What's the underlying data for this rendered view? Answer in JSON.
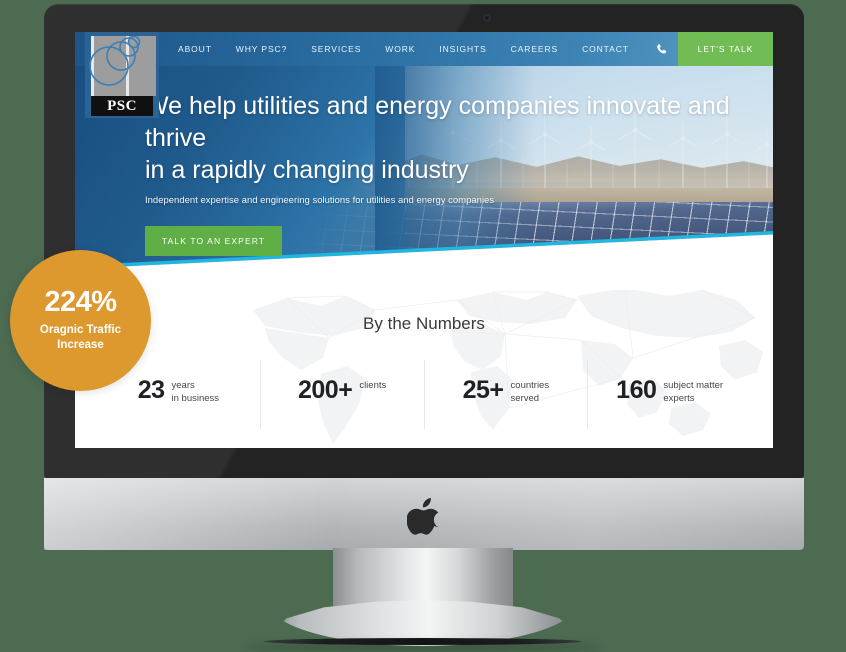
{
  "badge": {
    "number": "224%",
    "caption": "Oragnic Traffic\nIncrease",
    "caption_line1": "Oragnic Traffic",
    "caption_line2": "Increase",
    "color": "#dd982e"
  },
  "device": {
    "brand_icon": "apple-logo",
    "frame_color": "#232323",
    "chin_color": "#c3c6c8"
  },
  "site": {
    "logo": {
      "name": "PSC",
      "icon": "psc-rings-logo"
    },
    "nav": {
      "items": [
        {
          "label": "ABOUT"
        },
        {
          "label": "WHY PSC?"
        },
        {
          "label": "SERVICES"
        },
        {
          "label": "WORK"
        },
        {
          "label": "INSIGHTS"
        },
        {
          "label": "CAREERS"
        },
        {
          "label": "CONTACT"
        }
      ],
      "icons": [
        {
          "name": "phone-icon"
        },
        {
          "name": "search-icon"
        }
      ],
      "cta": {
        "label": "LET'S TALK",
        "color": "#72bc55"
      }
    },
    "hero": {
      "headline_line1": "We help utilities and energy companies innovate and thrive",
      "headline_line2": "in a rapidly changing industry",
      "subheadline": "Independent expertise and engineering solutions for utilities and energy companies",
      "cta_label": "TALK TO AN EXPERT",
      "cta_color": "#5fae46",
      "accent_line_color": "#1fb6e0"
    },
    "numbers": {
      "title": "By the Numbers",
      "stats": [
        {
          "value": "23",
          "label_line1": "years",
          "label_line2": "in business"
        },
        {
          "value": "200+",
          "label_line1": "clients",
          "label_line2": ""
        },
        {
          "value": "25+",
          "label_line1": "countries",
          "label_line2": "served"
        },
        {
          "value": "160",
          "label_line1": "subject matter",
          "label_line2": "experts"
        }
      ]
    }
  }
}
